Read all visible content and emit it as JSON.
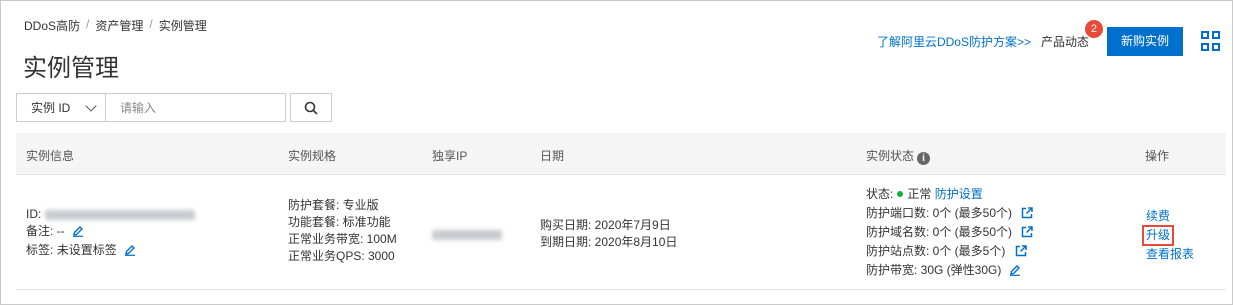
{
  "breadcrumb": [
    "DDoS高防",
    "资产管理",
    "实例管理"
  ],
  "breadcrumb_sep": "/",
  "page_title": "实例管理",
  "top": {
    "learn_link": "了解阿里云DDoS防护方案>>",
    "news_label": "产品动态",
    "news_badge": "2",
    "buy_button": "新购实例"
  },
  "search": {
    "select_value": "实例 ID",
    "placeholder": "请输入"
  },
  "columns": {
    "info": "实例信息",
    "spec": "实例规格",
    "ip": "独享IP",
    "date": "日期",
    "status": "实例状态",
    "ops": "操作"
  },
  "row": {
    "id_label": "ID:",
    "note_label": "备注:",
    "note_value": "--",
    "tag_label": "标签:",
    "tag_value": "未设置标签",
    "spec": [
      "防护套餐:  专业版",
      "功能套餐:  标准功能",
      "正常业务带宽:  100M",
      "正常业务QPS:  3000"
    ],
    "buy_date": "购买日期: 2020年7月9日",
    "expire_date": "到期日期: 2020年8月10日",
    "status_label": "状态:",
    "status_value": "正常",
    "protect_settings": "防护设置",
    "port_count": "防护端口数: 0个 (最多50个)",
    "domain_count": "防护域名数: 0个 (最多50个)",
    "site_count": "防护站点数: 0个 (最多5个)",
    "bandwidth": "防护带宽:  30G (弹性30G)",
    "ops": [
      "续费",
      "升级",
      "查看报表"
    ]
  },
  "colors": {
    "primary": "#0070cc",
    "badge": "#e84a3a",
    "status_ok": "#12b33a",
    "highlight_border": "#e84a3a"
  }
}
